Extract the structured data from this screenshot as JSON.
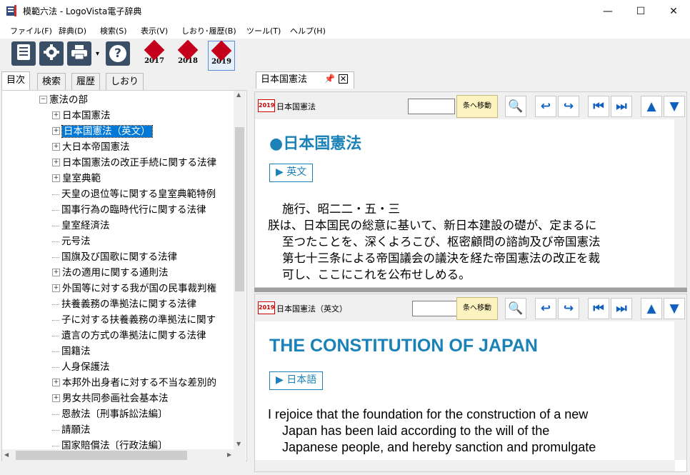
{
  "window": {
    "title": "模範六法 - LogoVista電子辞典",
    "controls": {
      "minimize": "—",
      "maximize": "☐",
      "close": "✕"
    }
  },
  "menu": [
    "ファイル(F)",
    "辞典(D)",
    "検索(S)",
    "表示(V)",
    "しおり･履歴(B)",
    "ツール(T)",
    "ヘルプ(H)"
  ],
  "toolbar": {
    "icons": [
      "dictionary-icon",
      "gear-icon",
      "print-icon",
      "help-icon"
    ],
    "dropdown_glyph": "▾",
    "help_glyph": "?",
    "years": [
      {
        "seal": "模範",
        "year": "2017"
      },
      {
        "seal": "模範",
        "year": "2018"
      },
      {
        "seal": "模範",
        "year": "2019"
      }
    ]
  },
  "left_tabs": [
    "目次",
    "検索",
    "履歴",
    "しおり"
  ],
  "tree": {
    "root": "憲法の部",
    "items": [
      {
        "label": "日本国憲法",
        "expandable": true
      },
      {
        "label": "日本国憲法（英文）",
        "expandable": true,
        "selected": true
      },
      {
        "label": "大日本帝国憲法",
        "expandable": true
      },
      {
        "label": "日本国憲法の改正手続に関する法律",
        "expandable": true
      },
      {
        "label": "皇室典範",
        "expandable": true
      },
      {
        "label": "天皇の退位等に関する皇室典範特例",
        "expandable": false
      },
      {
        "label": "国事行為の臨時代行に関する法律",
        "expandable": false
      },
      {
        "label": "皇室経済法",
        "expandable": false
      },
      {
        "label": "元号法",
        "expandable": false
      },
      {
        "label": "国旗及び国歌に関する法律",
        "expandable": false
      },
      {
        "label": "法の適用に関する通則法",
        "expandable": true
      },
      {
        "label": "外国等に対する我が国の民事裁判権",
        "expandable": true
      },
      {
        "label": "扶養義務の準拠法に関する法律",
        "expandable": false
      },
      {
        "label": "子に対する扶養義務の準拠法に関す",
        "expandable": false
      },
      {
        "label": "遺言の方式の準拠法に関する法律",
        "expandable": false
      },
      {
        "label": "国籍法",
        "expandable": false
      },
      {
        "label": "人身保護法",
        "expandable": false
      },
      {
        "label": "本邦外出身者に対する不当な差別的",
        "expandable": true
      },
      {
        "label": "男女共同参画社会基本法",
        "expandable": true
      },
      {
        "label": "恩赦法〔刑事訴訟法編〕",
        "expandable": false
      },
      {
        "label": "請願法",
        "expandable": false
      },
      {
        "label": "国家賠償法〔行政法編〕",
        "expandable": false
      }
    ]
  },
  "doc_tab": {
    "label": "日本国憲法",
    "close": "✕"
  },
  "pane_top": {
    "badge": "2019",
    "title": "日本国憲法",
    "jump_label": "条へ移動",
    "heading": "●日本国憲法",
    "link": "▶ 英文",
    "lines": [
      "施行、昭二二・五・三",
      "朕は、日本国民の総意に基いて、新日本建設の礎が、定まるに",
      "至つたことを、深くよろこび、枢密顧問の諮詢及び帝国憲法",
      "第七十三条による帝国議会の議決を経た帝国憲法の改正を裁",
      "可し、ここにこれを公布せしめる。"
    ]
  },
  "pane_bottom": {
    "badge": "2019",
    "title": "日本国憲法（英文）",
    "jump_label": "条へ移動",
    "heading": "THE CONSTITUTION OF JAPAN",
    "link": "▶ 日本語",
    "lines": [
      "I rejoice that the foundation for the construction of a new",
      "Japan has been laid according to the will of the",
      "Japanese people, and hereby sanction and promulgate"
    ]
  },
  "nav_glyphs": {
    "search": "🔍",
    "back": "↩",
    "forward": "↪",
    "first": "⏮",
    "last": "⏭",
    "up": "▲",
    "down": "▼"
  },
  "scroll_glyphs": {
    "up": "▲",
    "down": "▼",
    "left": "◀",
    "right": "▶"
  }
}
